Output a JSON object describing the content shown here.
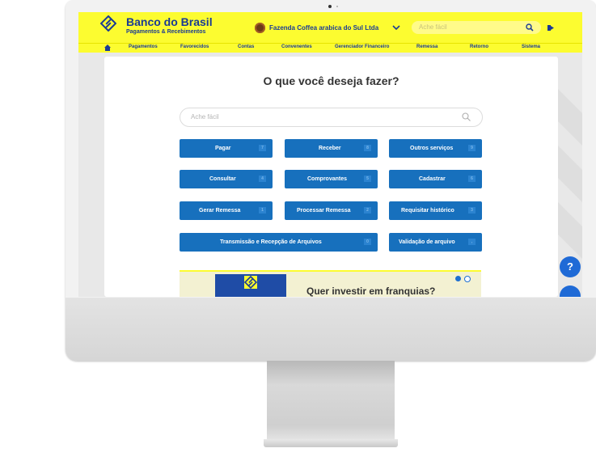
{
  "brand": {
    "name": "Banco do Brasil",
    "subtitle": "Pagamentos & Recebimentos"
  },
  "company": {
    "name": "Fazenda Coffea arabica do Sul Ltda"
  },
  "header_search": {
    "placeholder": "Ache fácil"
  },
  "nav": {
    "items": [
      "Pagamentos",
      "Favorecidos",
      "Contas",
      "Convenentes",
      "Gerenciador Financeiro",
      "Remessa",
      "Retorno",
      "Sistema"
    ]
  },
  "main": {
    "title": "O que você deseja fazer?",
    "search_placeholder": "Ache fácil"
  },
  "actions": [
    {
      "label": "Pagar",
      "badge": "7"
    },
    {
      "label": "Receber",
      "badge": "8"
    },
    {
      "label": "Outros serviços",
      "badge": "9"
    },
    {
      "label": "Consultar",
      "badge": "4"
    },
    {
      "label": "Comprovantes",
      "badge": "5"
    },
    {
      "label": "Cadastrar",
      "badge": "6"
    },
    {
      "label": "Gerar Remessa",
      "badge": "1"
    },
    {
      "label": "Processar Remessa",
      "badge": "2"
    },
    {
      "label": "Requisitar histórico",
      "badge": "3"
    },
    {
      "label": "Transmissão e Recepção de Arquivos",
      "badge": "0"
    },
    {
      "label": "Validação de arquivo",
      "badge": ","
    }
  ],
  "banner": {
    "text": "Quer investir em franquias?",
    "slide_count": 2,
    "active_slide": 1
  },
  "help": {
    "label": "?"
  },
  "colors": {
    "header_yellow": "#fcfc30",
    "brand_blue": "#1a3a95",
    "button_blue": "#1770bd"
  }
}
